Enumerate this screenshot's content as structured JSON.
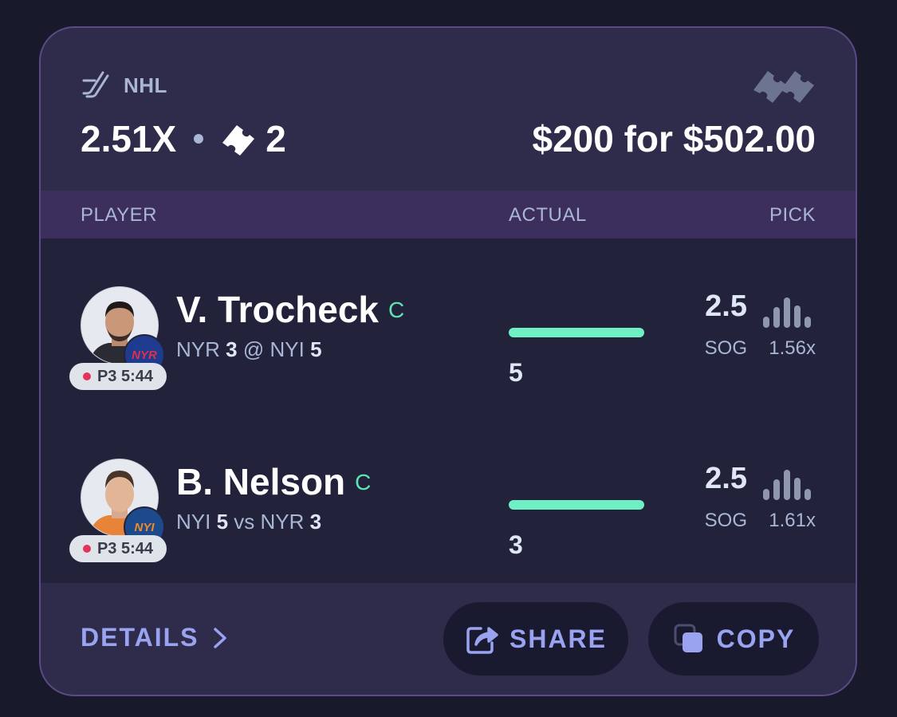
{
  "header": {
    "league": "NHL",
    "league_icon": "hockey-sticks-icon",
    "multiplier": "2.51X",
    "ticket_count": "2",
    "payout": "$200 for $502.00"
  },
  "columns": {
    "player": "PLAYER",
    "actual": "ACTUAL",
    "pick": "PICK"
  },
  "picks": [
    {
      "name": "V. Trocheck",
      "position": "C",
      "team_badge": "NYR",
      "status": "P3 5:44",
      "matchup": {
        "team": "NYR",
        "team_score": "3",
        "sep": "@",
        "opp": "NYI",
        "opp_score": "5"
      },
      "actual": "5",
      "actual_progress": 1.0,
      "line": "2.5",
      "stat": "SOG",
      "pick_multiplier": "1.56x"
    },
    {
      "name": "B. Nelson",
      "position": "C",
      "team_badge": "NYI",
      "status": "P3 5:44",
      "matchup": {
        "team": "NYI",
        "team_score": "5",
        "sep": "vs",
        "opp": "NYR",
        "opp_score": "3"
      },
      "actual": "3",
      "actual_progress": 1.0,
      "line": "2.5",
      "stat": "SOG",
      "pick_multiplier": "1.61x"
    }
  ],
  "footer": {
    "details": "DETAILS",
    "share": "SHARE",
    "copy": "COPY"
  },
  "colors": {
    "accent_green": "#6ff0c4",
    "accent_purple": "#9aa3f0",
    "live_red": "#e3355c"
  }
}
